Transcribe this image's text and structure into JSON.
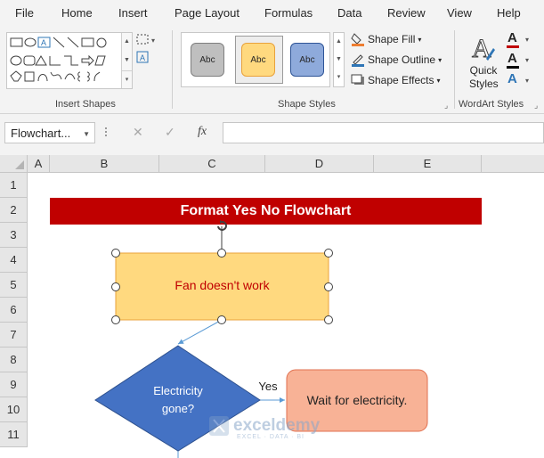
{
  "menu": {
    "items": [
      "File",
      "Home",
      "Insert",
      "Page Layout",
      "Formulas",
      "Data",
      "Review",
      "View",
      "Help"
    ]
  },
  "ribbon": {
    "insert_shapes": {
      "label": "Insert Shapes"
    },
    "shape_styles": {
      "label": "Shape Styles",
      "styles": [
        {
          "text": "Abc",
          "fill": "#bfbfbf",
          "border": "#7f7f7f",
          "color": "#262626"
        },
        {
          "text": "Abc",
          "fill": "#ffd97f",
          "border": "#e9a23b",
          "color": "#262626"
        },
        {
          "text": "Abc",
          "fill": "#8eaadb",
          "border": "#2f5597",
          "color": "#262626"
        }
      ],
      "shape_fill": "Shape Fill",
      "shape_outline": "Shape Outline",
      "shape_effects": "Shape Effects"
    },
    "wordart_styles": {
      "label": "WordArt Styles",
      "quick_styles": "Quick Styles",
      "text_fill_color": "#c00000",
      "text_outline_color": "#000000",
      "text_effects_color": "#2e75b6"
    }
  },
  "formula_bar": {
    "name_box": "Flowchart...",
    "cancel": "✕",
    "enter": "✓",
    "function": "fx",
    "formula": ""
  },
  "grid": {
    "columns": [
      "A",
      "B",
      "C",
      "D",
      "E"
    ],
    "rows": [
      "1",
      "2",
      "3",
      "4",
      "5",
      "6",
      "7",
      "8",
      "9",
      "10",
      "11"
    ]
  },
  "flowchart": {
    "title": "Format Yes No Flowchart",
    "process_text": "Fan doesn't work",
    "decision_line1": "Electricity",
    "decision_line2": "gone?",
    "yes_label": "Yes",
    "wait_text": "Wait for electricity."
  },
  "watermark": {
    "name": "exceldemy",
    "tagline": "EXCEL · DATA · BI"
  },
  "colors": {
    "title_banner": "#c00000",
    "process_fill": "#ffd97f",
    "process_border": "#e9a23b",
    "process_text": "#c00000",
    "decision_fill": "#4472c4",
    "wait_fill": "#f8b296",
    "wait_border": "#e07050",
    "connector": "#5b9bd5"
  }
}
